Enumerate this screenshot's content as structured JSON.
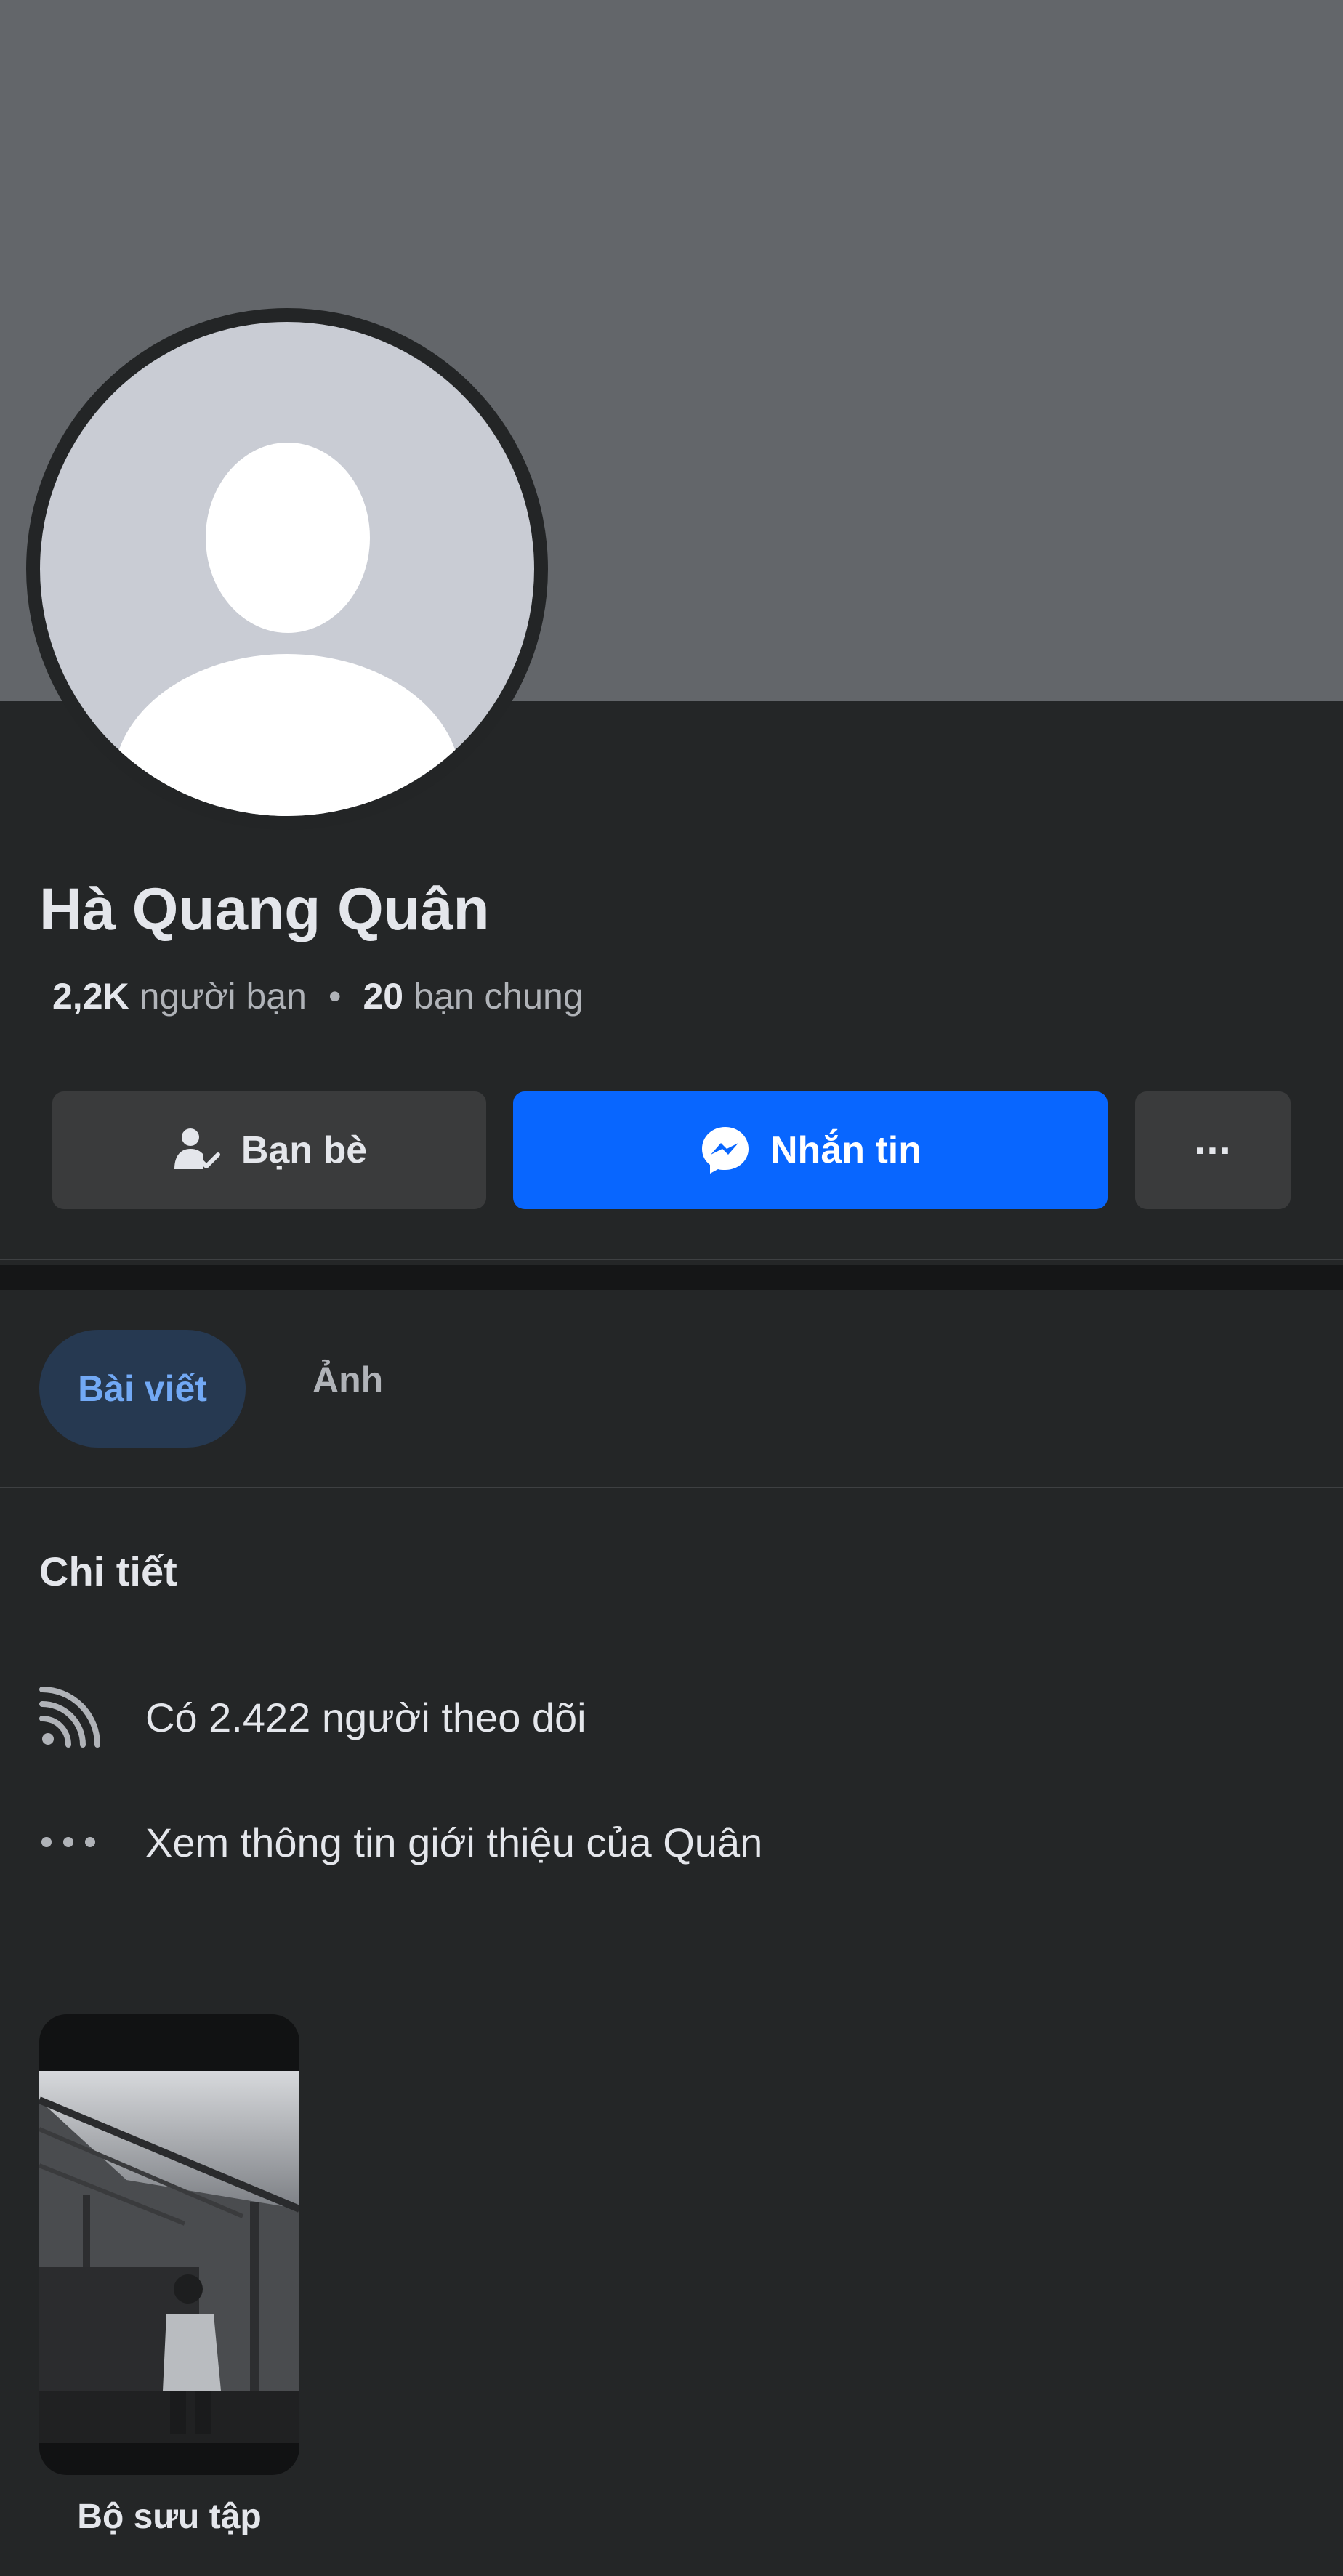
{
  "profile": {
    "name": "Hà Quang Quân",
    "friends_count": "2,2K",
    "friends_label": "người bạn",
    "separator": "•",
    "mutual_count": "20",
    "mutual_label": "bạn chung"
  },
  "actions": {
    "friends_label": "Bạn bè",
    "message_label": "Nhắn tin",
    "more_label": "···",
    "friends_icon": "friend-check-icon",
    "message_icon": "messenger-icon"
  },
  "tabs": [
    {
      "label": "Bài viết",
      "active": true
    },
    {
      "label": "Ảnh",
      "active": false
    }
  ],
  "details": {
    "title": "Chi tiết",
    "items": [
      {
        "icon": "rss-follow-icon",
        "text": "Có 2.422 người theo dõi"
      },
      {
        "icon": "more-dots-icon",
        "text": "Xem thông tin giới thiệu của Quân"
      }
    ]
  },
  "collection": {
    "label": "Bộ sưu tập"
  },
  "colors": {
    "background": "#242627",
    "cover": "#63666a",
    "accent": "#0866ff",
    "active_tab_bg": "#263951",
    "active_tab_text": "#72a9f5"
  }
}
